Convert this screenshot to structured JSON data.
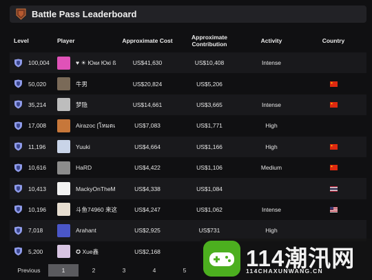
{
  "title": "Battle Pass Leaderboard",
  "columns": {
    "level": "Level",
    "player": "Player",
    "cost": "Approximate Cost",
    "contribution": "Approximate Contribution",
    "activity": "Activity",
    "country": "Country"
  },
  "rows": [
    {
      "level": "100,004",
      "player": "♥ ☀ Юки Юкі ß",
      "cost": "US$41,630",
      "contribution": "US$10,408",
      "activity": "Intense",
      "country": "",
      "avatar_color": "#e052b8"
    },
    {
      "level": "50,020",
      "player": "牛男",
      "cost": "US$20,824",
      "contribution": "US$5,206",
      "activity": "",
      "country": "CN",
      "avatar_color": "#7a6a58"
    },
    {
      "level": "35,214",
      "player": "梦隐",
      "cost": "US$14,661",
      "contribution": "US$3,665",
      "activity": "Intense",
      "country": "CN",
      "avatar_color": "#bdbdbd"
    },
    {
      "level": "17,008",
      "player": "Airazoc [โหมดเ",
      "cost": "US$7,083",
      "contribution": "US$1,771",
      "activity": "High",
      "country": "",
      "avatar_color": "#c7773a"
    },
    {
      "level": "11,196",
      "player": "Yuuki",
      "cost": "US$4,664",
      "contribution": "US$1,166",
      "activity": "High",
      "country": "CN",
      "avatar_color": "#c9d4e8"
    },
    {
      "level": "10,616",
      "player": "HaRD",
      "cost": "US$4,422",
      "contribution": "US$1,106",
      "activity": "Medium",
      "country": "CN",
      "avatar_color": "#8c8c8c"
    },
    {
      "level": "10,413",
      "player": "MackyOnTheM",
      "cost": "US$4,338",
      "contribution": "US$1,084",
      "activity": "",
      "country": "TH",
      "avatar_color": "#f2f2f2"
    },
    {
      "level": "10,196",
      "player": "斗鱼74960 来这",
      "cost": "US$4,247",
      "contribution": "US$1,062",
      "activity": "Intense",
      "country": "US",
      "avatar_color": "#e6ddd0"
    },
    {
      "level": "7,018",
      "player": "Arahant",
      "cost": "US$2,925",
      "contribution": "US$731",
      "activity": "High",
      "country": "",
      "avatar_color": "#4a56c8"
    },
    {
      "level": "5,200",
      "player": "✪ Xue鑫",
      "cost": "US$2,168",
      "contribution": "",
      "activity": "",
      "country": "",
      "avatar_color": "#d8c4e2"
    }
  ],
  "pagination": {
    "previous": "Previous",
    "pages": [
      "1",
      "2",
      "3",
      "4",
      "5"
    ],
    "current": "1"
  },
  "watermark": {
    "big": "114潮汛网",
    "small": "114CHAXUNWANG.CN"
  },
  "colors": {
    "background": "#101012",
    "row_alt": "#19191c",
    "shield": "#8f9bea",
    "flag_cn": "#de2910",
    "watermark_green": "#4caf1f"
  }
}
